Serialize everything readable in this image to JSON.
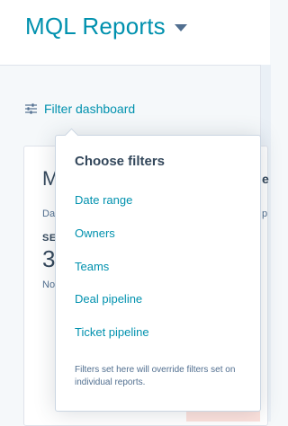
{
  "header": {
    "dashboard_title": "MQL Reports",
    "dropdown_icon": "caret-down-icon"
  },
  "toolbar": {
    "filter_label": "Filter dashboard",
    "filter_icon": "sliders-icon"
  },
  "report_card": {
    "title_partial": "M",
    "subtitle_partial": "Da",
    "caption_partial": "SE",
    "value_partial": "3",
    "note_partial": "No",
    "right_heading_partial": "e",
    "right_sub_partial": "p"
  },
  "filters_popover": {
    "heading": "Choose filters",
    "options": [
      "Date range",
      "Owners",
      "Teams",
      "Deal pipeline",
      "Ticket pipeline"
    ],
    "footnote": "Filters set here will override filters set on individual reports."
  },
  "colors": {
    "link": "#0091ae",
    "text_dark": "#33475b",
    "text_muted": "#516f90",
    "border": "#cbd6e2"
  }
}
